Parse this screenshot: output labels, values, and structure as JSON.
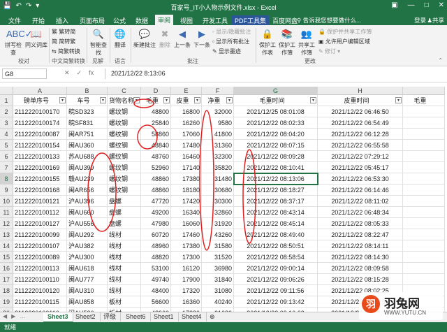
{
  "window": {
    "title": "百家号_IT小人物示例文件.xlsx - Excel",
    "qat_icons": [
      "save-icon",
      "undo-icon",
      "redo-icon",
      "customize-icon"
    ],
    "controls": [
      "ribbon-display-icon",
      "minimize-icon",
      "maximize-icon",
      "close-icon"
    ]
  },
  "menu": {
    "tabs": [
      "文件",
      "开始",
      "插入",
      "页面布局",
      "公式",
      "数据",
      "审阅",
      "视图",
      "开发工具",
      "PDF工具集",
      "百度网盘"
    ],
    "active_tab": "审阅",
    "tell_me": "告诉我您想要做什么...",
    "login": "登录",
    "share": "共享"
  },
  "ribbon": {
    "spellcheck": "拼写检查",
    "thesaurus": "同义词库",
    "group_proofing": "校对",
    "to_traditional": "繁转简",
    "to_simplified": "简转繁",
    "convert": "简繁转换",
    "group_chinese": "中文简繁转换",
    "smart_lookup": "智能查找",
    "group_insights": "见解",
    "translate": "翻译",
    "group_language": "语言",
    "new_comment": "新建批注",
    "delete": "删除",
    "previous": "上一条",
    "next": "下一条",
    "show_hide_comment": "显示/隐藏批注",
    "show_all_comments": "显示所有批注",
    "show_ink": "显示墨迹",
    "group_comments": "批注",
    "protect_sheet": "保护工作表",
    "protect_workbook": "保护工作簿",
    "share_workbook": "共享工作簿",
    "protect_share": "保护并共享工作簿",
    "allow_edit_ranges": "允许用户编辑区域",
    "track_changes": "修订",
    "group_changes": "更改"
  },
  "formula_bar": {
    "name_box": "G8",
    "fx": "fx",
    "content": "2021/12/22  8:13:06"
  },
  "sheet": {
    "columns": [
      "A",
      "B",
      "C",
      "D",
      "E",
      "F",
      "G",
      "H"
    ],
    "selected_column": "G",
    "selected_row": 8,
    "headers": [
      "磅单序号",
      "车号",
      "货物名称",
      "毛重",
      "皮重",
      "净重",
      "毛重时间",
      "皮重时间",
      "毛重"
    ],
    "rows": [
      [
        "2112220100170",
        "皖SD323",
        "螺纹钢",
        "48800",
        "16800",
        "32000",
        "2021/12/25 08:01:08",
        "2021/12/22 06:46:50"
      ],
      [
        "2112220100174",
        "皖SF831",
        "螺纹钢",
        "25840",
        "16260",
        "9580",
        "2021/12/22 08:02:33",
        "2021/12/22 06:54:49"
      ],
      [
        "2112220100087",
        "闽AR751",
        "螺纹钢",
        "58860",
        "17060",
        "41800",
        "2021/12/22 08:04:20",
        "2021/12/22 06:12:28"
      ],
      [
        "2112220100154",
        "闽AU360",
        "螺纹钢",
        "48840",
        "17480",
        "31360",
        "2021/12/22 08:07:15",
        "2021/12/22 06:55:58"
      ],
      [
        "2112220100133",
        "苏AU688",
        "螺纹钢",
        "48760",
        "16460",
        "32300",
        "2021/12/22 08:09:28",
        "2021/12/22 07:29:12"
      ],
      [
        "2112220100169",
        "闽AU399",
        "螺纹钢",
        "52960",
        "17140",
        "35820",
        "2021/12/22 08:10:41",
        "2021/12/22 05:45:17"
      ],
      [
        "2112220100155",
        "赣AU239",
        "螺纹钢",
        "48860",
        "17380",
        "31480",
        "2021/12/22 08:13:06",
        "2021/12/22 06:53:30"
      ],
      [
        "2112220100168",
        "闽AR656",
        "螺纹钢",
        "48860",
        "18180",
        "30680",
        "2021/12/22 08:18:27",
        "2021/12/22 06:14:46"
      ],
      [
        "2112220100121",
        "沪AU396",
        "盘螺",
        "47720",
        "17420",
        "30300",
        "2021/12/22 08:37:17",
        "2021/12/22 08:11:02"
      ],
      [
        "2112220100112",
        "闽AU660",
        "盘螺",
        "49200",
        "16340",
        "32860",
        "2021/12/22 08:43:14",
        "2021/12/22 06:48:34"
      ],
      [
        "2112220100127",
        "沪AU556",
        "盘螺",
        "47980",
        "16060",
        "31920",
        "2021/12/22 08:45:14",
        "2021/12/22 08:05:33"
      ],
      [
        "2112220100099",
        "闽AU292",
        "线材",
        "60720",
        "17460",
        "43260",
        "2021/12/22 08:49:40",
        "2021/12/22 08:22:47"
      ],
      [
        "2112220100107",
        "沪AU382",
        "线材",
        "48960",
        "17380",
        "31580",
        "2021/12/22 08:50:51",
        "2021/12/22 08:14:11"
      ],
      [
        "2112220100089",
        "沪AU300",
        "线材",
        "48820",
        "17300",
        "31520",
        "2021/12/22 08:58:54",
        "2021/12/22 08:14:30"
      ],
      [
        "2112220100113",
        "闽AU618",
        "线材",
        "53100",
        "16120",
        "36980",
        "2021/12/22 09:00:14",
        "2021/12/22 08:09:58"
      ],
      [
        "2112220100110",
        "闽AU777",
        "线材",
        "49740",
        "17900",
        "31840",
        "2021/12/22 09:06:26",
        "2021/12/22 08:15:28"
      ],
      [
        "2112220100120",
        "闽AU310",
        "线材",
        "48400",
        "17320",
        "31080",
        "2021/12/22 09:11:56",
        "2021/12/22 08:02:25"
      ],
      [
        "2112220100115",
        "闽AU858",
        "板材",
        "56600",
        "16360",
        "40240",
        "2021/12/22 09:13:42",
        "2021/12/22 08:47:32"
      ],
      [
        "2112220100116",
        "闽AU536",
        "板材",
        "48960",
        "17280",
        "31680",
        "2021/12/22 09:16:02",
        "2021/12/22 08:53:02"
      ],
      [
        "2112220100178",
        "京AU396",
        "板材",
        "48980",
        "17260",
        "31720",
        "2021/12/22 09:18:09",
        "2021/12/22 09:06:22"
      ]
    ]
  },
  "sheet_tabs": [
    "Sheet3",
    "Sheet2",
    "评级",
    "Sheet6",
    "Sheet1",
    "Sheet4"
  ],
  "active_sheet": "Sheet3",
  "status": {
    "ready": "就绪"
  },
  "watermark": {
    "logo_char": "羽",
    "name": "羽兔网",
    "url": "WWW.YUTU.CN"
  }
}
